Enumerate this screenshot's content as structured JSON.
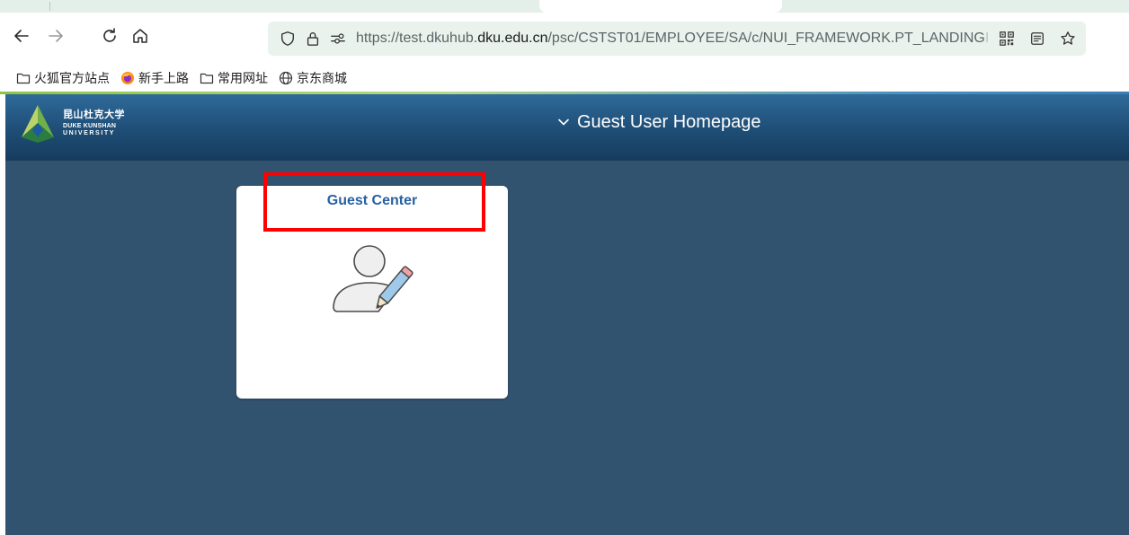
{
  "browser": {
    "url_prefix": "https://test.dkuhub.",
    "url_host": "dku.edu.cn",
    "url_path": "/psc/CSTST01/EMPLOYEE/SA/c/NUI_FRAMEWORK.PT_LANDING",
    "url_overflow": "I",
    "bookmarks": [
      {
        "label": "火狐官方站点"
      },
      {
        "label": "新手上路"
      },
      {
        "label": "常用网址"
      },
      {
        "label": "京东商城"
      }
    ]
  },
  "app": {
    "logo": {
      "zh": "昆山杜克大学",
      "en_line1": "DUKE KUNSHAN",
      "en_line2": "UNIVERSITY"
    },
    "page_title": "Guest User Homepage",
    "tiles": [
      {
        "title": "Guest Center",
        "icon": "user-edit-icon"
      }
    ],
    "colors": {
      "background": "#32536f",
      "header_top": "#2f6a9a",
      "tile_title": "#2660a4",
      "highlight": "#ff0000"
    }
  }
}
